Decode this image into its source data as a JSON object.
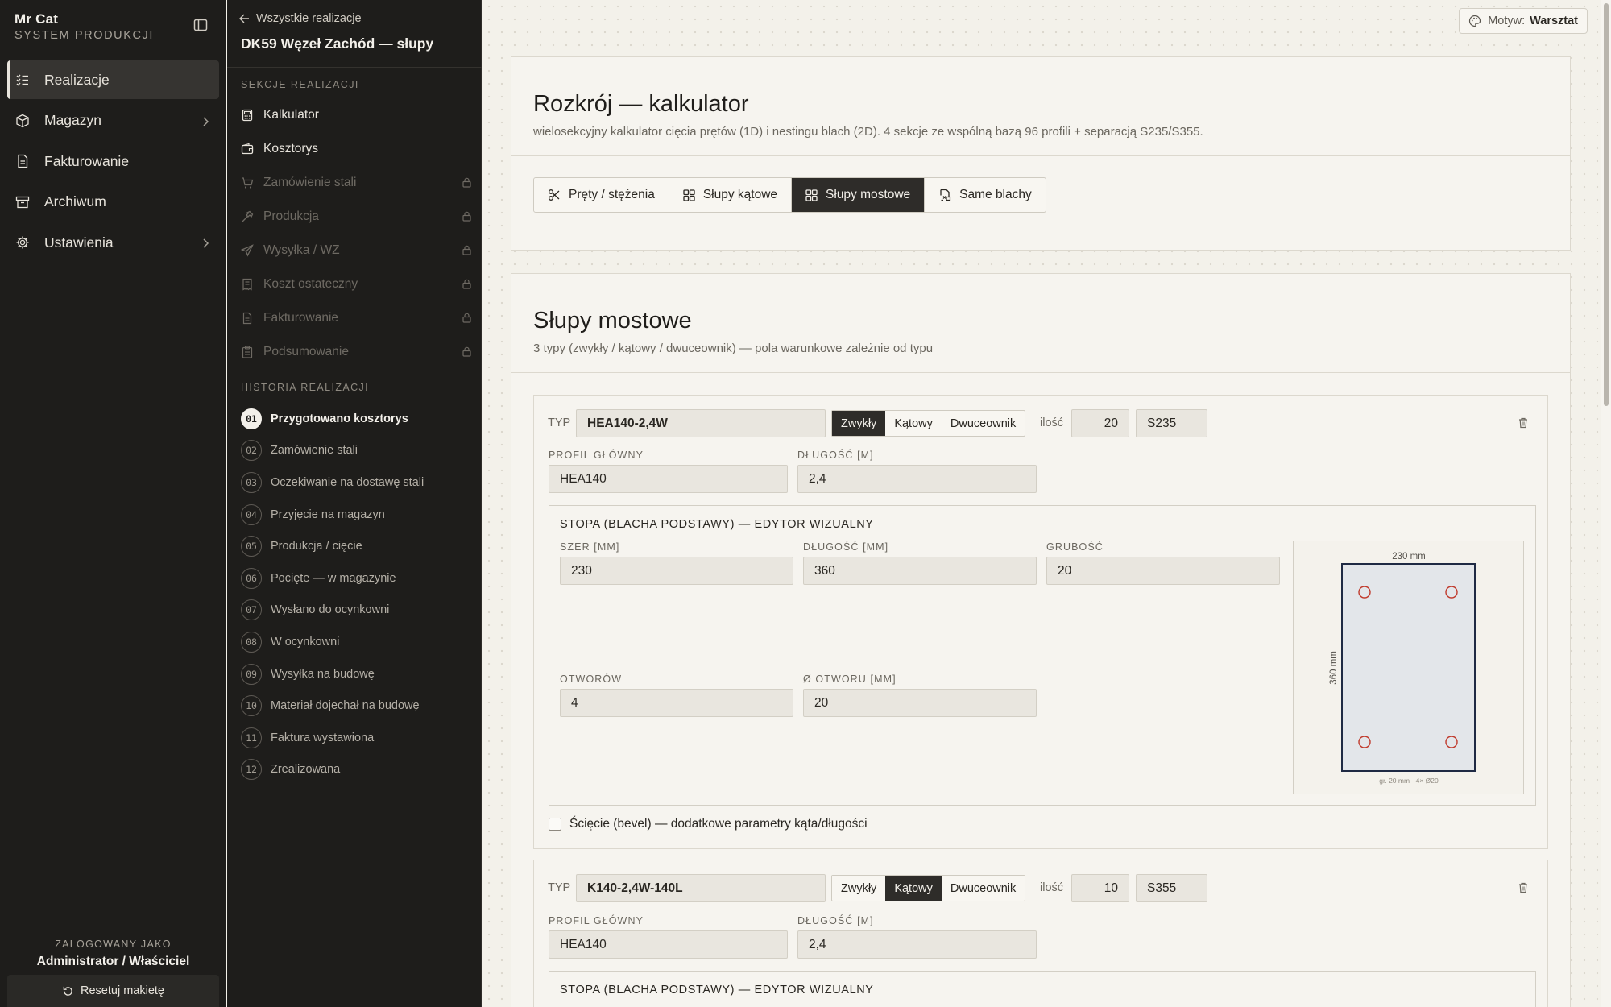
{
  "app": {
    "brand": "Mr Cat",
    "brand_sub": "SYSTEM PRODUKCJI"
  },
  "sidebar": {
    "items": [
      {
        "label": "Realizacje",
        "icon": "list-check-icon",
        "active": true
      },
      {
        "label": "Magazyn",
        "icon": "package-icon",
        "chevron": true
      },
      {
        "label": "Fakturowanie",
        "icon": "document-icon"
      },
      {
        "label": "Archiwum",
        "icon": "archive-icon"
      },
      {
        "label": "Ustawienia",
        "icon": "gear-icon",
        "chevron": true
      }
    ],
    "user_caption": "ZALOGOWANY JAKO",
    "user_role": "Administrator / Właściciel",
    "reset_label": "Resetuj makietę"
  },
  "panel": {
    "back_label": "Wszystkie realizacje",
    "project_title": "DK59 Węzeł Zachód — słupy",
    "sections_caption": "SEKCJE REALIZACJI",
    "sections": [
      {
        "label": "Kalkulator",
        "icon": "calculator-icon",
        "locked": false
      },
      {
        "label": "Kosztorys",
        "icon": "wallet-icon",
        "locked": false
      },
      {
        "label": "Zamówienie stali",
        "icon": "cart-icon",
        "locked": true
      },
      {
        "label": "Produkcja",
        "icon": "hammer-icon",
        "locked": true
      },
      {
        "label": "Wysyłka / WZ",
        "icon": "send-icon",
        "locked": true
      },
      {
        "label": "Koszt ostateczny",
        "icon": "receipt-icon",
        "locked": true
      },
      {
        "label": "Fakturowanie",
        "icon": "invoice-icon",
        "locked": true
      },
      {
        "label": "Podsumowanie",
        "icon": "clipboard-icon",
        "locked": true
      }
    ],
    "history_caption": "HISTORIA REALIZACJI",
    "history": [
      {
        "num": "01",
        "label": "Przygotowano kosztorys",
        "current": true
      },
      {
        "num": "02",
        "label": "Zamówienie stali"
      },
      {
        "num": "03",
        "label": "Oczekiwanie na dostawę stali"
      },
      {
        "num": "04",
        "label": "Przyjęcie na magazyn"
      },
      {
        "num": "05",
        "label": "Produkcja / cięcie"
      },
      {
        "num": "06",
        "label": "Pocięte — w magazynie"
      },
      {
        "num": "07",
        "label": "Wysłano do ocynkowni"
      },
      {
        "num": "08",
        "label": "W ocynkowni"
      },
      {
        "num": "09",
        "label": "Wysyłka na budowę"
      },
      {
        "num": "10",
        "label": "Materiał dojechał na budowę"
      },
      {
        "num": "11",
        "label": "Faktura wystawiona"
      },
      {
        "num": "12",
        "label": "Zrealizowana"
      }
    ]
  },
  "theme": {
    "label": "Motyw:",
    "value": "Warsztat"
  },
  "calculator": {
    "title": "Rozkrój — kalkulator",
    "subtitle": "wielosekcyjny kalkulator cięcia prętów (1D) i nestingu blach (2D). 4 sekcje ze wspólną bazą 96 profili + separacją S235/S355.",
    "tabs": [
      {
        "label": "Pręty / stężenia",
        "icon": "scissors-icon"
      },
      {
        "label": "Słupy kątowe",
        "icon": "grid-icon"
      },
      {
        "label": "Słupy mostowe",
        "icon": "grid-icon",
        "active": true
      },
      {
        "label": "Same blachy",
        "icon": "sheet-icon"
      }
    ]
  },
  "section": {
    "title": "Słupy mostowe",
    "subtitle": "3 typy (zwykły / kątowy / dwuceownik) — pola warunkowe zależnie od typu"
  },
  "labels": {
    "typ": "TYP",
    "ilosc": "ilość",
    "profile": "PROFIL GŁÓWNY",
    "length_m": "DŁUGOŚĆ [M]",
    "foot_title": "STOPA (BLACHA PODSTAWY) — EDYTOR WIZUALNY",
    "width_mm": "SZER [MM]",
    "length_mm": "DŁUGOŚĆ [MM]",
    "thickness": "GRUBOŚĆ",
    "holes": "OTWORÓW",
    "hole_dia": "Ø OTWORU [MM]",
    "bevel": "Ścięcie (bevel) — dodatkowe parametry kąta/długości",
    "type_options": [
      "Zwykły",
      "Kątowy",
      "Dwuceownik"
    ]
  },
  "posts": [
    {
      "type_code": "HEA140-2,4W",
      "type_selected": "Zwykły",
      "quantity": "20",
      "grade": "S235",
      "profile": "HEA140",
      "length": "2,4",
      "plate": {
        "width": "230",
        "length": "360",
        "thickness": "20",
        "holes": "4",
        "hole_dia": "20",
        "dim_top": "230 mm",
        "dim_side": "360 mm",
        "note": "gr. 20 mm · 4× Ø20"
      },
      "bevel_checked": false
    },
    {
      "type_code": "K140-2,4W-140L",
      "type_selected": "Kątowy",
      "quantity": "10",
      "grade": "S355",
      "profile": "HEA140",
      "length": "2,4"
    }
  ],
  "colors": {
    "sidebar_bg": "#1e1d1b",
    "main_bg": "#f3f1ea",
    "accent_dark": "#2e2c29",
    "hole_red": "#c0392b",
    "plate_fill": "#e3e6ea",
    "plate_stroke": "#1f2a44"
  }
}
